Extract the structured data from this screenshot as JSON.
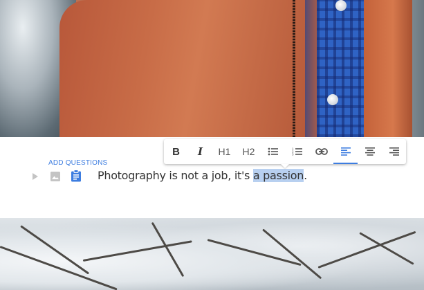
{
  "editor": {
    "add_questions_label": "ADD QUESTIONS",
    "text_before": "Photography is not a job, it's ",
    "text_selected": "a passion",
    "text_after": "."
  },
  "toolbar": {
    "bold_label": "B",
    "italic_label": "I",
    "h1_label": "H1",
    "h2_label": "H2",
    "bullet_list_icon": "bullet-list-icon",
    "numbered_list_icon": "numbered-list-icon",
    "link_icon": "link-icon",
    "align_left_icon": "align-left-icon",
    "align_center_icon": "align-center-icon",
    "align_right_icon": "align-right-icon",
    "active_alignment": "left"
  },
  "colors": {
    "accent": "#3d7de0",
    "selection": "#b8d0f0",
    "text": "#333333",
    "icon_gray": "#c4c4c4"
  }
}
